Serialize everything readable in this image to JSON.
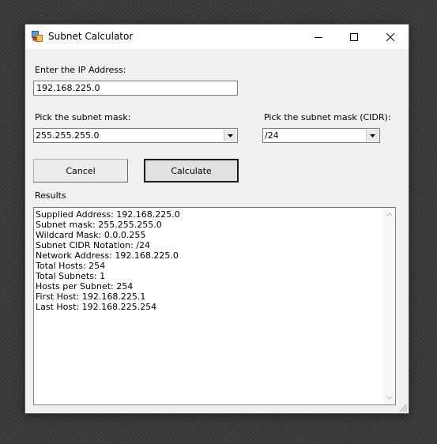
{
  "window": {
    "title": "Subnet Calculator"
  },
  "ip_section": {
    "label": "Enter the IP Address:",
    "value": "192.168.225.0"
  },
  "mask_section": {
    "label": "Pick the subnet mask:",
    "selected": "255.255.255.0"
  },
  "cidr_section": {
    "label": "Pick the subnet mask (CIDR):",
    "selected": "/24"
  },
  "buttons": {
    "cancel": "Cancel",
    "calculate": "Calculate"
  },
  "results": {
    "label": "Results",
    "lines": [
      "Supplied Address: 192.168.225.0",
      "Subnet mask: 255.255.255.0",
      "Wildcard Mask: 0.0.0.255",
      "Subnet CIDR Notation: /24",
      "Network Address: 192.168.225.0",
      "Total Hosts: 254",
      "Total Subnets: 1",
      "Hosts per Subnet: 254",
      "First Host: 192.168.225.1",
      "Last Host: 192.168.225.254"
    ]
  },
  "icons": {
    "app": "app-icon",
    "minimize": "minimize-icon",
    "maximize": "maximize-icon",
    "close": "close-icon",
    "dropdown": "chevron-down-icon",
    "scroll_up": "scroll-up-icon",
    "scroll_down": "scroll-down-icon",
    "resize": "resize-grip-icon"
  }
}
